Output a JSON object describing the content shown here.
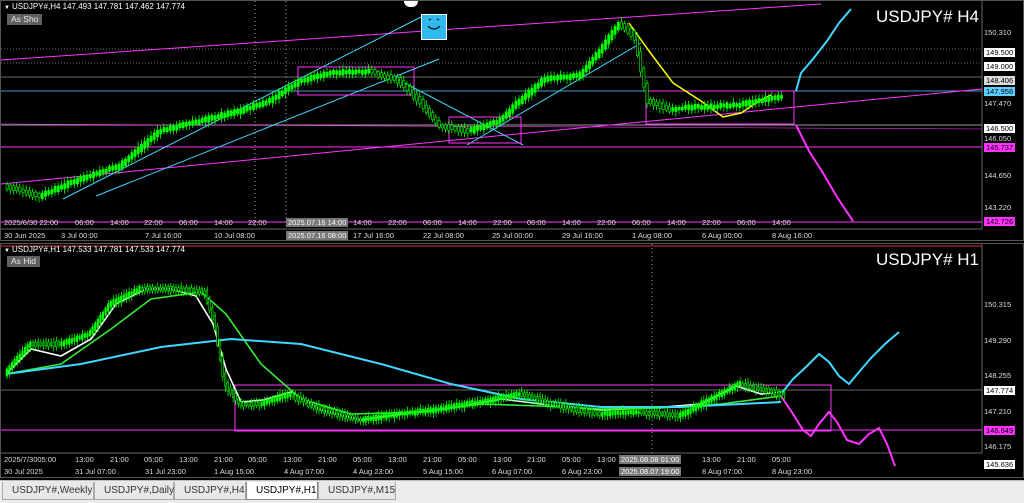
{
  "chart_top": {
    "header": "USDJPY#,H4  147.493 147.781 147.462 147.774",
    "toggle_button": "As Sho",
    "title": "USDJPY#  H4",
    "price_labels": [
      "150.310",
      "149.500",
      "149.000",
      "148.406",
      "147.470",
      "146.500",
      "146.050",
      "144.650",
      "143.220"
    ],
    "boxed_prices": [
      {
        "text": "147.956",
        "bg": "#5ed0ff",
        "fg": "#000"
      },
      {
        "text": "145.737",
        "bg": "#ff33ff",
        "fg": "#000"
      },
      {
        "text": "142.726",
        "bg": "#ff33ff",
        "fg": "#000"
      }
    ],
    "time_labels": [
      "2025/6/30 22:00",
      "06:00",
      "14:00",
      "22:00",
      "06:00",
      "14:00",
      "22:00",
      "06:00",
      "14:00",
      "22:00",
      "06:00",
      "14:00",
      "22:00",
      "06:00",
      "14:00",
      "22:00",
      "06:00",
      "14:00",
      "22:00",
      "06:00",
      "14:00",
      "22:00"
    ],
    "time_labels_row2": [
      "30 Jun 2025",
      "3 Jul 00:00",
      "7 Jul 16:00",
      "10 Jul 08:00",
      "17 Jul 16:00",
      "22 Jul 08:00",
      "25 Jul 00:00",
      "29 Jul 16:00",
      "1 Aug 08:00",
      "6 Aug 00:00",
      "8 Aug 16:00"
    ],
    "cursor_time_1": "2025.07.16 14:00",
    "cursor_time_2": "2025.07.16 08:00"
  },
  "chart_bottom": {
    "header": "USDJPY#,H1  147.533 147.781 147.533 147.774",
    "toggle_button": "As Hid",
    "title": "USDJPY#  H1",
    "price_labels": [
      "150.315",
      "149.290",
      "148.255",
      "147.210",
      "146.175"
    ],
    "boxed_prices": [
      {
        "text": "147.774",
        "bg": "#ffffff",
        "fg": "#000"
      },
      {
        "text": "146.649",
        "bg": "#ff33ff",
        "fg": "#000"
      },
      {
        "text": "145.636",
        "bg": "#ffffff",
        "fg": "#000"
      }
    ],
    "time_labels": [
      "2025/7/3005:00",
      "13:00",
      "21:00",
      "05:00",
      "13:00",
      "21:00",
      "05:00",
      "13:00",
      "21:00",
      "05:00",
      "13:00",
      "21:00",
      "05:00",
      "13:00",
      "21:00",
      "05:00",
      "13:00",
      "21:00",
      "05:00",
      "13:00",
      "21:00",
      "05:00"
    ],
    "time_labels_row2": [
      "30 Jul 2025",
      "31 Jul 07:00",
      "31 Jul 23:00",
      "1 Aug 15:00",
      "4 Aug 07:00",
      "4 Aug 23:00",
      "5 Aug 15:00",
      "6 Aug 07:00",
      "6 Aug 23:00",
      "8 Aug 07:00",
      "8 Aug 23:00"
    ],
    "cursor_time_1": "2025.08.08 01:00",
    "cursor_time_2": "2025.08.07 19:00"
  },
  "tabs": [
    "USDJPY#,Weekly",
    "USDJPY#,Daily",
    "USDJPY#,H4",
    "USDJPY#,H1",
    "USDJPY#,M15"
  ],
  "active_tab": "USDJPY#,H1",
  "colors": {
    "background": "#000000",
    "bull_candle": "#00ff00",
    "bear_candle": "#00ff00",
    "trendline_cyan": "#40d8ff",
    "trendline_magenta": "#ff33ff",
    "zigzag_yellow": "#ffff00",
    "ma_white": "#ffffff",
    "ma_green": "#33ee33",
    "ma_cyan": "#40d8ff"
  },
  "icons": [
    "triangle-down-icon",
    "close-icon",
    "smile-bulb-icon"
  ]
}
